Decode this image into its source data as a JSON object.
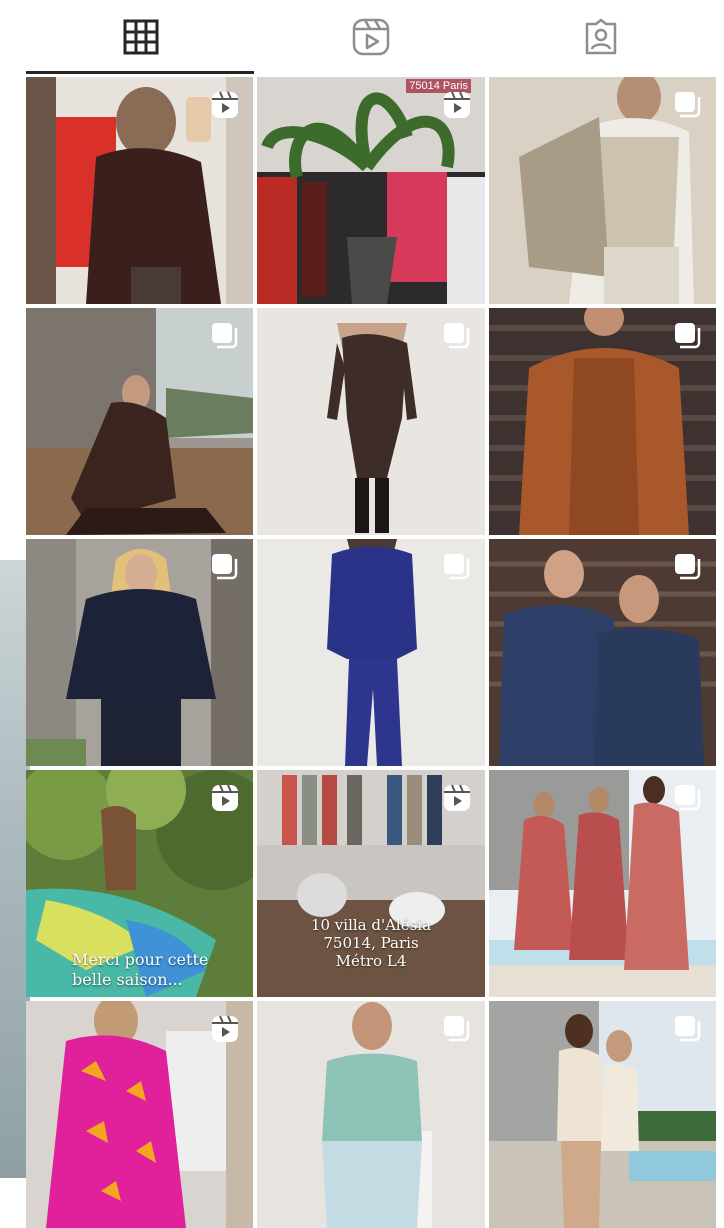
{
  "tabs": [
    {
      "id": "posts",
      "icon": "grid-icon",
      "active": true
    },
    {
      "id": "reels",
      "icon": "reels-icon",
      "active": false
    },
    {
      "id": "tagged",
      "icon": "tagged-person-icon",
      "active": false
    }
  ],
  "posts": [
    {
      "type": "reel",
      "subject": "mirror-selfie-brown-jacket"
    },
    {
      "type": "reel",
      "subject": "boutique-plant-clothing-rack",
      "tag": "75014 Paris"
    },
    {
      "type": "carousel",
      "subject": "man-beige-vest-coat"
    },
    {
      "type": "carousel",
      "subject": "woman-brown-outfit-seated"
    },
    {
      "type": "carousel",
      "subject": "off-shoulder-brown-dress"
    },
    {
      "type": "carousel",
      "subject": "man-rust-overshirt"
    },
    {
      "type": "carousel",
      "subject": "navy-cable-knit-sweater"
    },
    {
      "type": "carousel",
      "subject": "blue-double-breasted-suit"
    },
    {
      "type": "carousel",
      "subject": "two-men-blue-check-jackets"
    },
    {
      "type": "reel",
      "subject": "woman-colorful-scarf",
      "caption": "Merci pour cette\nbelle saison..."
    },
    {
      "type": "reel",
      "subject": "boutique-interior-cushions",
      "caption": "10 villa d'Alésia\n75014, Paris\nMétro L4"
    },
    {
      "type": "carousel",
      "subject": "three-people-printed-outfits"
    },
    {
      "type": "reel",
      "subject": "woman-pink-print-dress"
    },
    {
      "type": "carousel",
      "subject": "man-mint-tshirt"
    },
    {
      "type": "carousel",
      "subject": "two-men-knit-polos"
    }
  ],
  "colors": {
    "icon": "#262626",
    "indicator": "#262626",
    "background": "#ffffff",
    "badge": "#ffffff"
  }
}
